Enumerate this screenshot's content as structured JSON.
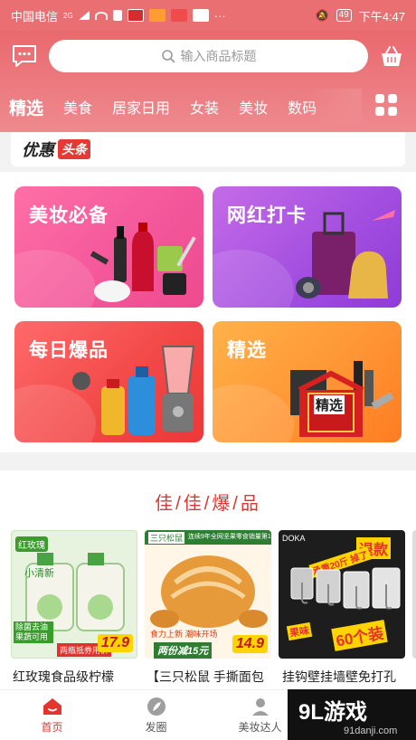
{
  "status_bar": {
    "carrier": "中国电信",
    "network": "2G",
    "battery": "49",
    "time": "下午4:47"
  },
  "header": {
    "search_placeholder": "输入商品标题",
    "icons": [
      "message-icon",
      "search-icon",
      "basket-icon",
      "grid-icon"
    ]
  },
  "tabs": [
    {
      "label": "精选",
      "active": true
    },
    {
      "label": "美食"
    },
    {
      "label": "居家日用"
    },
    {
      "label": "女装"
    },
    {
      "label": "美妆"
    },
    {
      "label": "数码"
    }
  ],
  "banner": {
    "title": "优惠",
    "tag": "头条"
  },
  "cards": [
    {
      "title": "美妆必备"
    },
    {
      "title": "网红打卡"
    },
    {
      "title": "每日爆品"
    },
    {
      "title": "精选"
    }
  ],
  "card_badge": "精选",
  "section": {
    "title": "佳/佳/爆/品"
  },
  "products": [
    {
      "name": "红玫瑰食品级柠檬",
      "price": "17.9",
      "brand": "红玫瑰",
      "line": "小清新",
      "badge": "除菌去油 果蔬可用",
      "deal": "两瓶抵券用价"
    },
    {
      "name": "【三只松鼠 手撕面包",
      "price": "14.9",
      "brand": "三只松鼠",
      "top": "连续9年全网坚果零食销量第1",
      "deal": "两份减15元",
      "badge": "食力上新 潮味开场"
    },
    {
      "name": "挂钩壁挂墙壁免打孔",
      "brand": "DOKA",
      "big": "退款",
      "count": "60个装",
      "note": "承重20斤 掉了",
      "extra": "果味"
    }
  ],
  "bottom_nav": [
    {
      "label": "首页",
      "active": true
    },
    {
      "label": "发圈"
    },
    {
      "label": "美妆达人"
    }
  ],
  "watermark": {
    "brand": "9L游戏",
    "url": "91danji.com"
  },
  "colors": {
    "accent": "#e2352f",
    "header_top": "#e9696e",
    "header_bottom": "#ee8a8f"
  }
}
